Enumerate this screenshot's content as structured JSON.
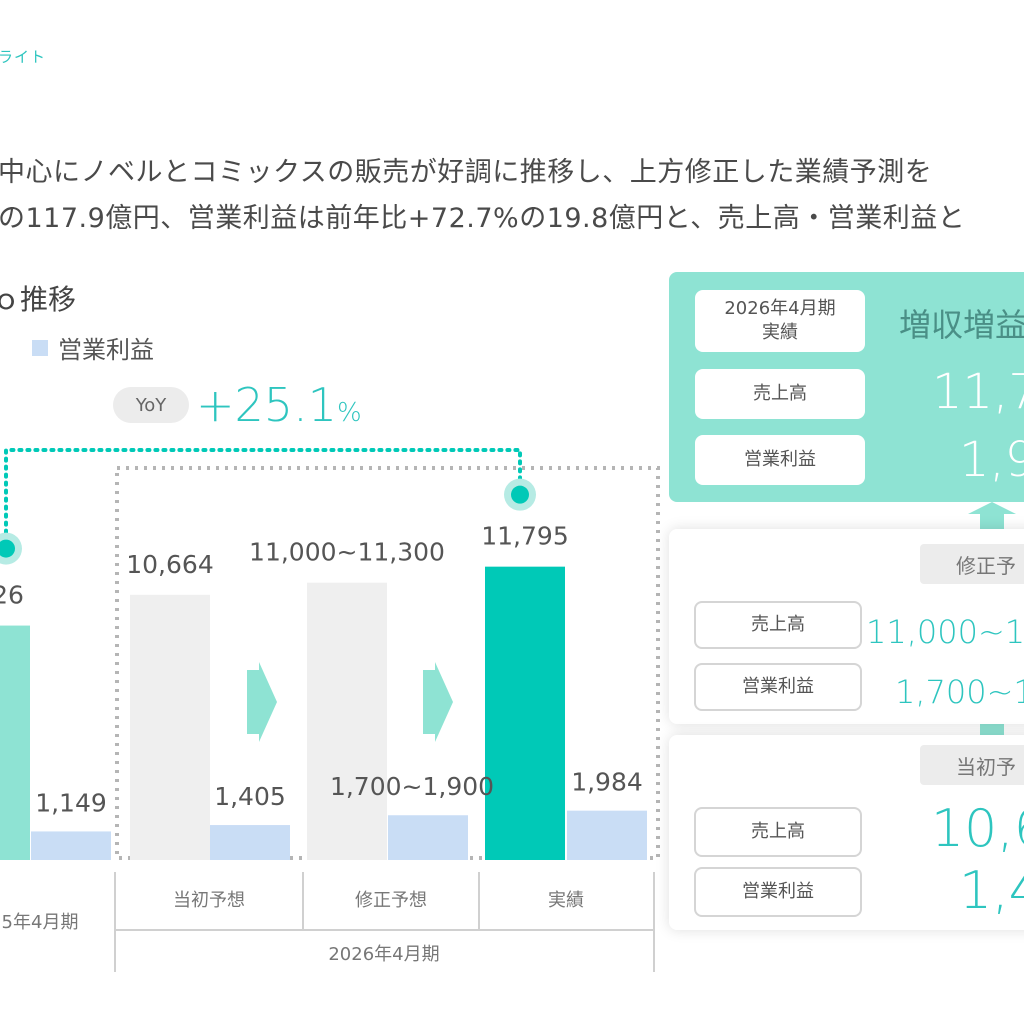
{
  "breadcrumb": "ライト",
  "summary": {
    "line1": "中心にノベルとコミックスの販売が好調に推移し、上方修正した業績予測を",
    "line2": "の117.9億円、営業利益は前年比+72.7%の19.8億円と、売上高・営業利益と"
  },
  "chart_heading": "推移",
  "legend": {
    "operating_profit": "営業利益"
  },
  "yoy": {
    "label": "YoY",
    "value": "+25.1",
    "unit": "%"
  },
  "colors": {
    "teal": "#00c9b7",
    "teal_light": "#8ee3d3",
    "grey_bar": "#efefef",
    "blue_bar": "#c9ddf5",
    "accent_text": "#2ec5bf"
  },
  "chart_data": {
    "type": "bar",
    "categories": [
      "5年4月期",
      "当初予想",
      "修正予想",
      "実績"
    ],
    "group_label": "2026年4月期",
    "series": [
      {
        "name": "",
        "values": [
          9426,
          10664,
          11150,
          11795
        ],
        "labels": [
          "26",
          "10,664",
          "11,000~11,300",
          "11,795"
        ],
        "range": [
          null,
          null,
          [
            11000,
            11300
          ],
          null
        ]
      },
      {
        "name": "営業利益",
        "values": [
          1149,
          1405,
          1800,
          1984
        ],
        "labels": [
          "1,149",
          "1,405",
          "1,700~1,900",
          "1,984"
        ],
        "range": [
          null,
          null,
          [
            1700,
            1900
          ],
          null
        ]
      }
    ],
    "ylim": [
      0,
      14000
    ]
  },
  "panels": {
    "actual": {
      "period": "2026年4月期\n実績",
      "headline": "増収増益",
      "sales_label": "売上高",
      "sales_value": "11,7",
      "op_label": "営業利益",
      "op_value": "1,9"
    },
    "revised": {
      "tag": "修正予",
      "sales_label": "売上高",
      "sales_value": "11,000~11",
      "op_label": "営業利益",
      "op_value": "1,700~1"
    },
    "initial": {
      "tag": "当初予",
      "sales_label": "売上高",
      "sales_value": "10,6",
      "op_label": "営業利益",
      "op_value": "1,4"
    }
  }
}
